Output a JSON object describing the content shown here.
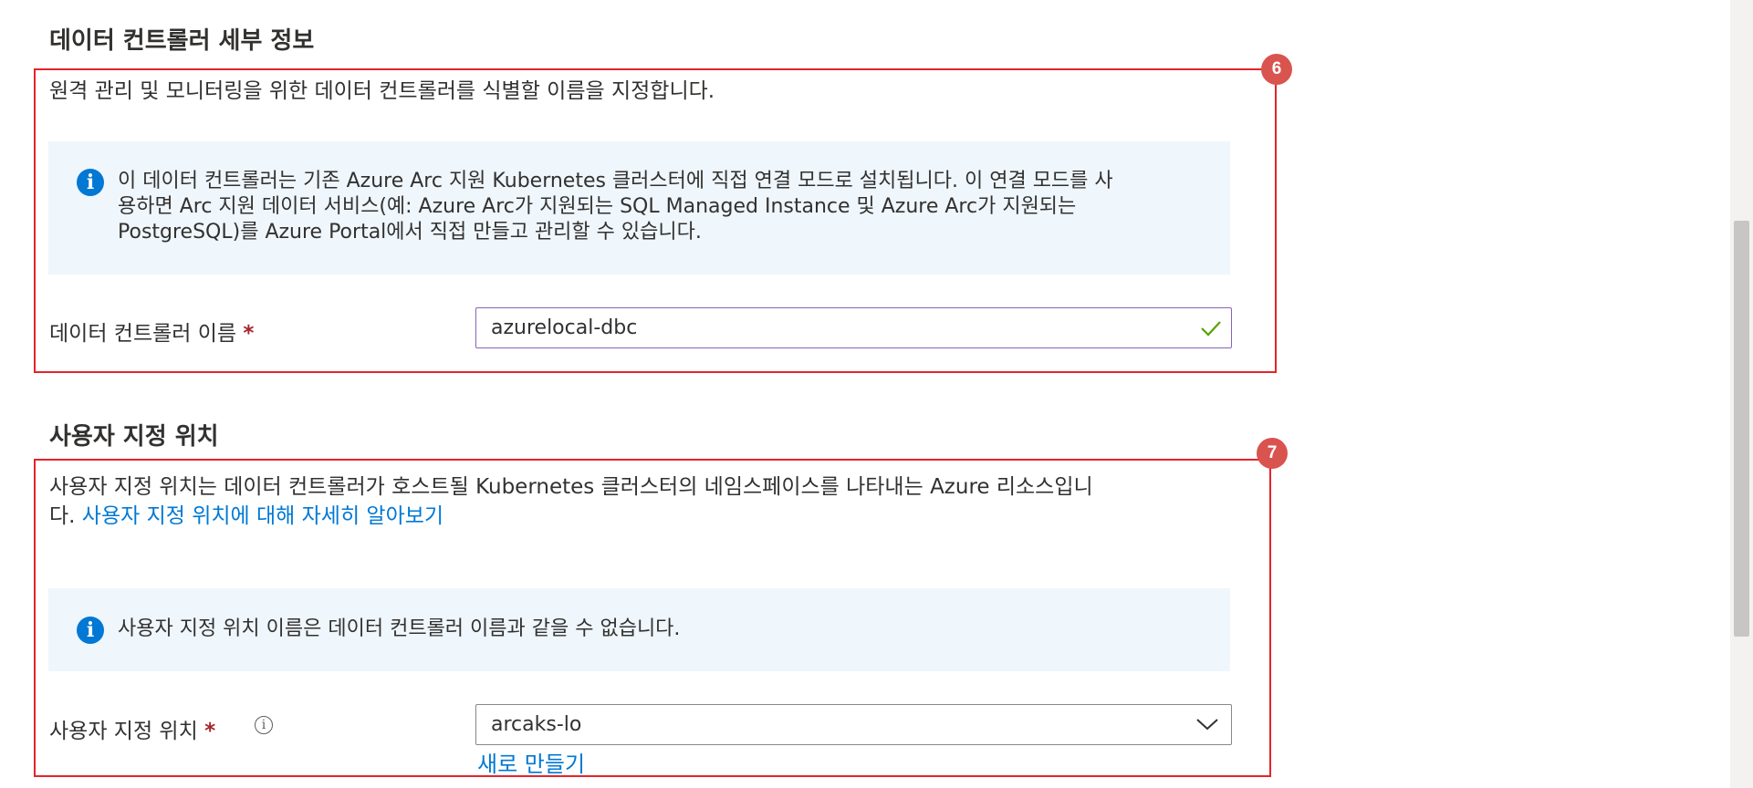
{
  "section1": {
    "title": "데이터 컨트롤러 세부 정보",
    "badge": "6",
    "description": "원격 관리 및 모니터링을 위한 데이터 컨트롤러를 식별할 이름을 지정합니다.",
    "info_lines": [
      "이 데이터 컨트롤러는 기존 Azure Arc 지원 Kubernetes 클러스터에 직접 연결 모드로 설치됩니다. 이 연결 모드를 사",
      "용하면 Arc 지원 데이터 서비스(예: Azure Arc가 지원되는 SQL Managed Instance 및 Azure Arc가 지원되는",
      "PostgreSQL)를 Azure Portal에서 직접 만들고 관리할 수 있습니다."
    ],
    "field_label": "데이터 컨트롤러 이름",
    "required_mark": "*",
    "field_value": "azurelocal-dbc"
  },
  "section2": {
    "title": "사용자 지정 위치",
    "badge": "7",
    "description_line1": "사용자 지정 위치는 데이터 컨트롤러가 호스트될 Kubernetes 클러스터의 네임스페이스를 나타내는 Azure 리소스입니",
    "description_line2": "다.",
    "learn_more_link": "사용자 지정 위치에 대해 자세히 알아보기",
    "info_text": "사용자 지정 위치 이름은 데이터 컨트롤러 이름과 같을 수 없습니다.",
    "field_label": "사용자 지정 위치",
    "required_mark": "*",
    "selected_value": "arcaks-lo",
    "create_new_link": "새로 만들기"
  },
  "icons": {
    "info": "info-icon",
    "checkmark": "checkmark-icon",
    "chevron": "chevron-down-icon",
    "tooltip": "tooltip-info-icon"
  },
  "colors": {
    "highlight_border": "#e3242b",
    "badge": "#d9534f",
    "info_bg": "#eff6fc",
    "info_icon": "#0078d4",
    "link": "#0078d4",
    "required": "#a4262c",
    "valid_check": "#57a300"
  }
}
